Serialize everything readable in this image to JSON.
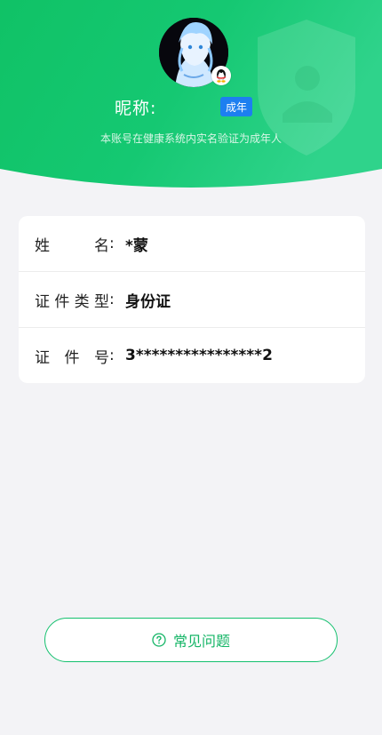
{
  "header": {
    "nickname_label": "昵称:",
    "age_badge": "成年",
    "verify_note": "本账号在健康系统内实名验证为成年人",
    "colors": {
      "accent_green": "#14c06e",
      "badge_blue": "#1d7ff0"
    }
  },
  "info": {
    "rows": [
      {
        "label_chars": [
          "姓",
          "名"
        ],
        "value": "*蒙"
      },
      {
        "label_chars": [
          "证",
          "件",
          "类",
          "型"
        ],
        "value": "身份证"
      },
      {
        "label_chars": [
          "证",
          "件",
          "号"
        ],
        "value": "3****************2"
      }
    ],
    "colon": ":"
  },
  "faq": {
    "label": "常见问题",
    "icon": "question-circle-icon"
  }
}
